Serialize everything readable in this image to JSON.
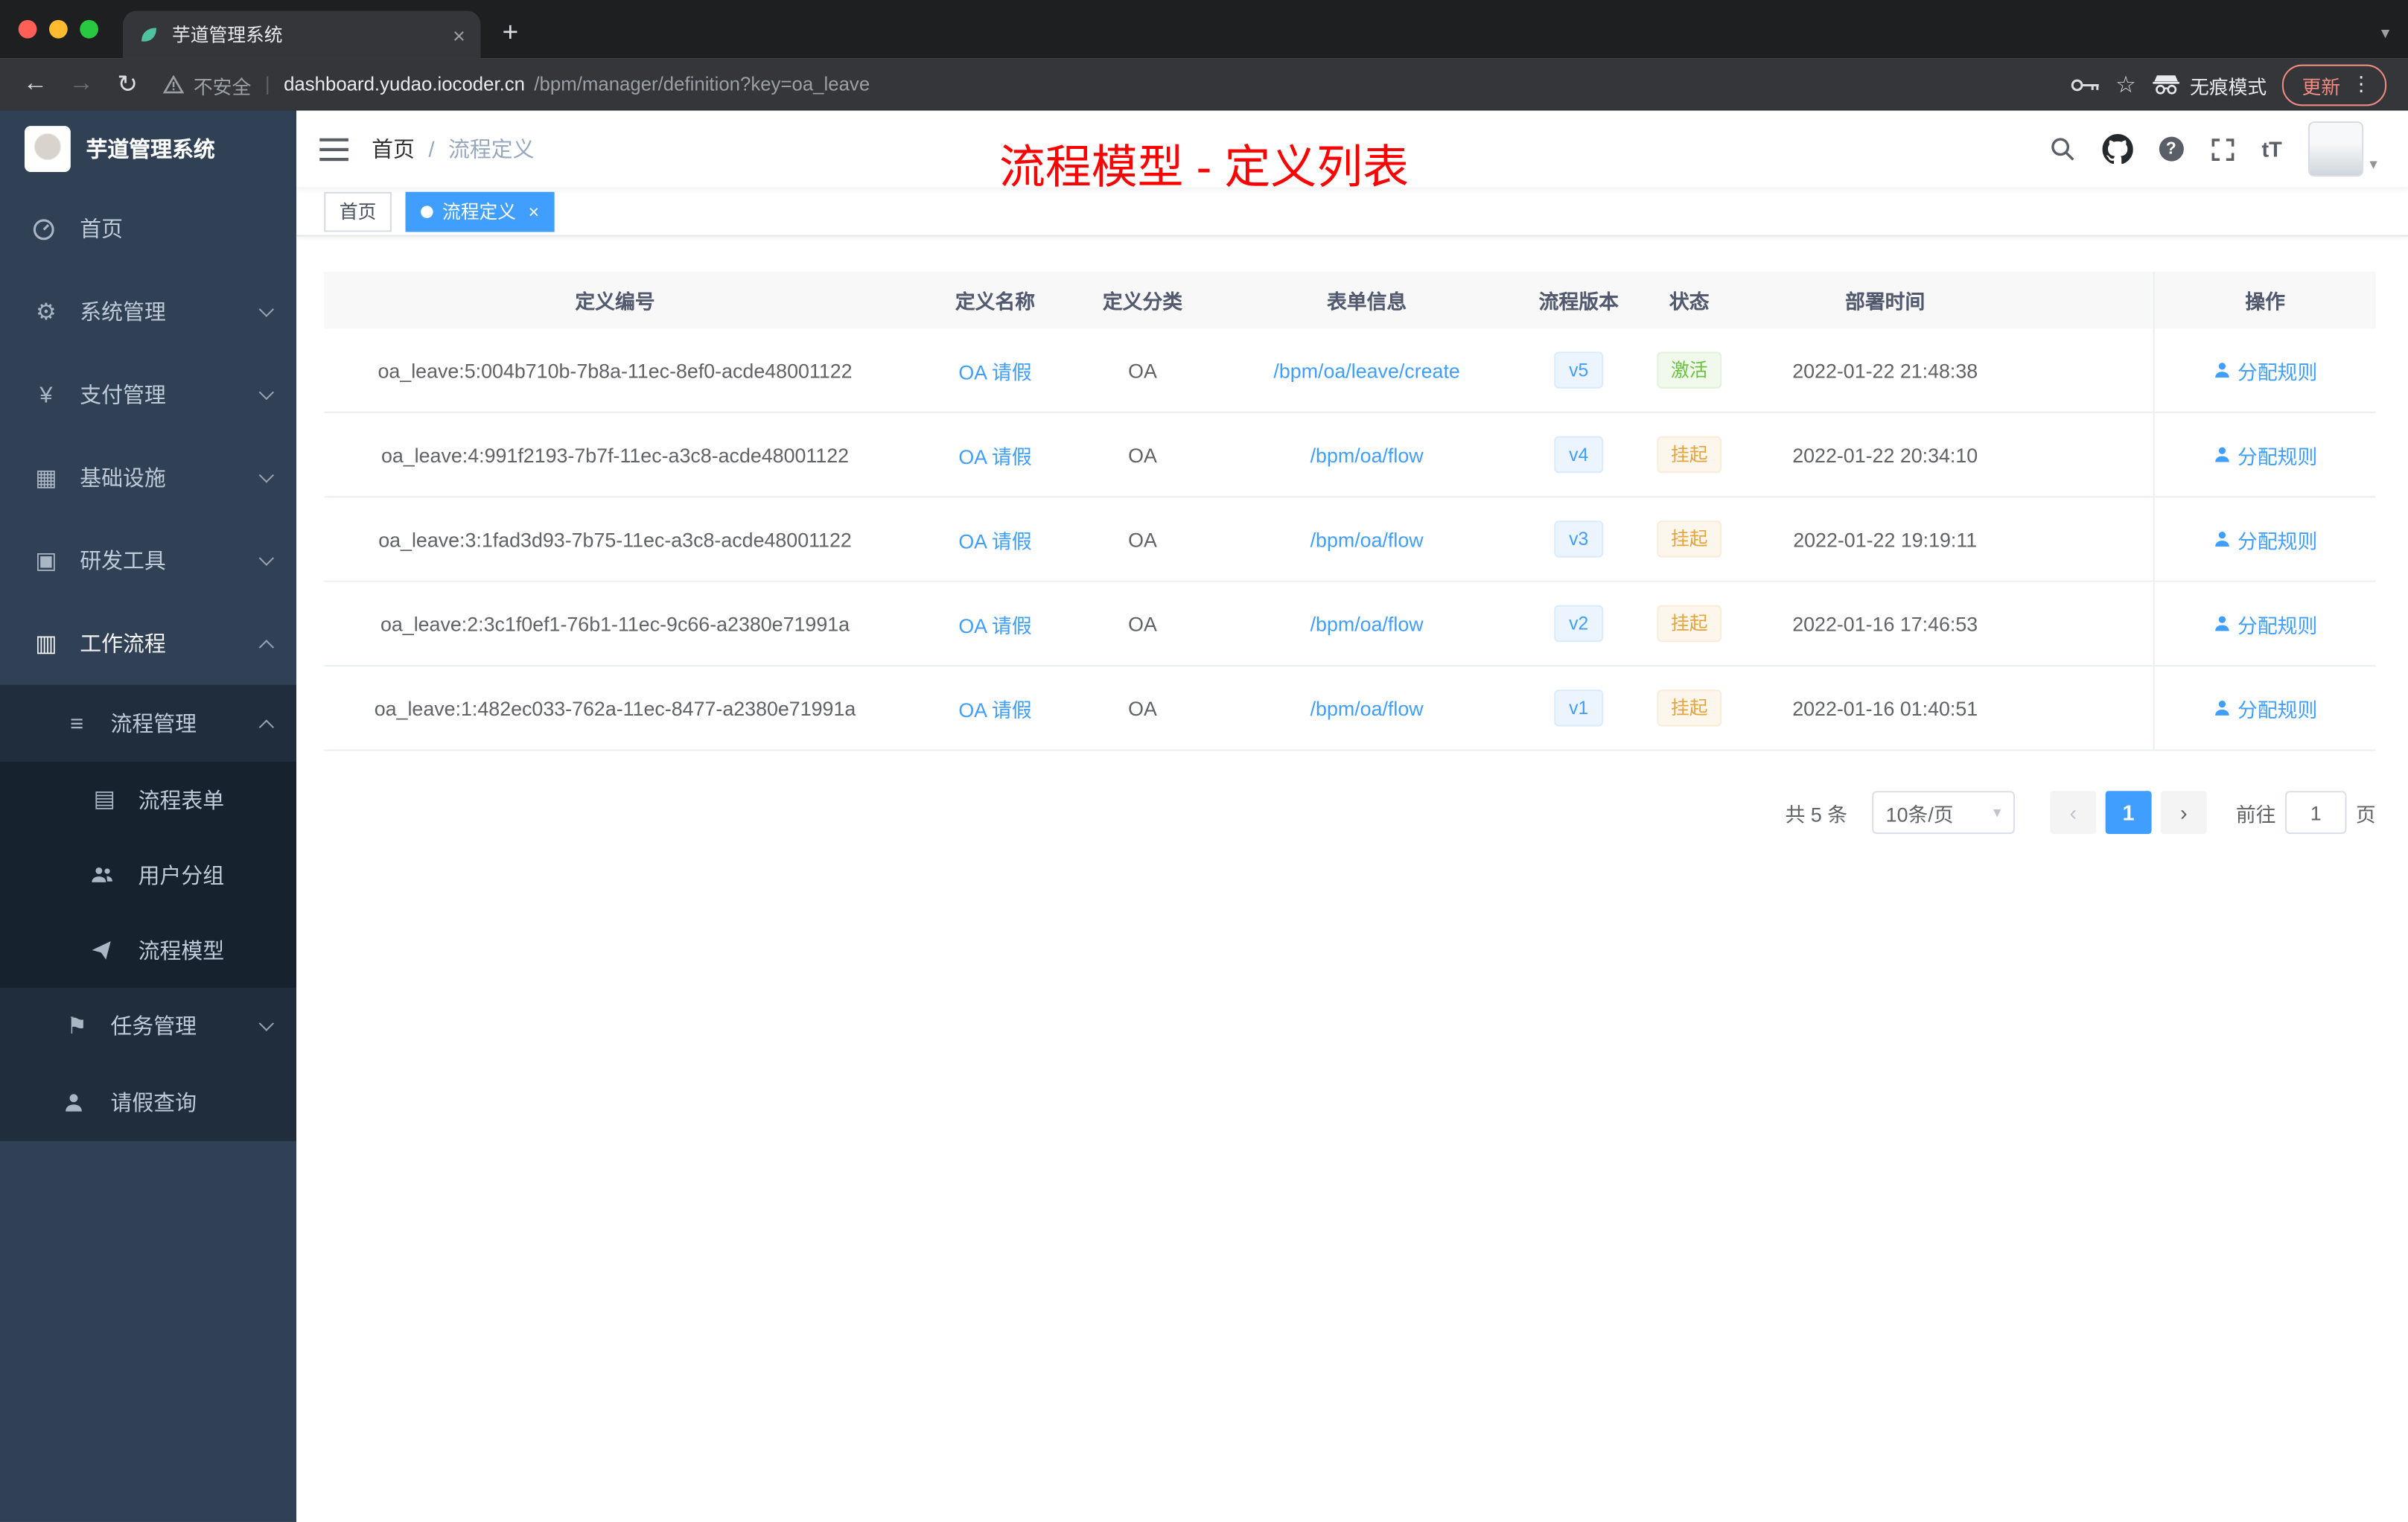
{
  "colors": {
    "accent": "#409eff",
    "success": "#67c23a",
    "warning": "#e6a23c",
    "annotation_red": "#ff0000",
    "sidebar_bg": "#304156",
    "submenu_bg": "#1f2d3d"
  },
  "browser": {
    "tab_title": "芋道管理系统",
    "security_label": "不安全",
    "url_host": "dashboard.yudao.iocoder.cn",
    "url_path": "/bpm/manager/definition?key=oa_leave",
    "incognito_label": "无痕模式",
    "update_label": "更新"
  },
  "sidebar": {
    "app_title": "芋道管理系统",
    "items": [
      {
        "label": "首页"
      },
      {
        "label": "系统管理"
      },
      {
        "label": "支付管理"
      },
      {
        "label": "基础设施"
      },
      {
        "label": "研发工具"
      },
      {
        "label": "工作流程"
      },
      {
        "label": "流程管理"
      },
      {
        "label": "流程表单"
      },
      {
        "label": "用户分组"
      },
      {
        "label": "流程模型"
      },
      {
        "label": "任务管理"
      },
      {
        "label": "请假查询"
      }
    ]
  },
  "navbar": {
    "breadcrumb_home": "首页",
    "breadcrumb_sep": "/",
    "breadcrumb_current": "流程定义",
    "annotation": "流程模型 - 定义列表",
    "font_icon_label": "tT"
  },
  "tags": {
    "home": "首页",
    "active": "流程定义"
  },
  "table": {
    "columns": [
      "定义编号",
      "定义名称",
      "定义分类",
      "表单信息",
      "流程版本",
      "状态",
      "部署时间",
      "操作"
    ],
    "rows": [
      {
        "id": "oa_leave:5:004b710b-7b8a-11ec-8ef0-acde48001122",
        "name": "OA 请假",
        "category": "OA",
        "form": "/bpm/oa/leave/create",
        "version": "v5",
        "status": "激活",
        "status_type": "success",
        "time": "2022-01-22 21:48:38",
        "action": "分配规则"
      },
      {
        "id": "oa_leave:4:991f2193-7b7f-11ec-a3c8-acde48001122",
        "name": "OA 请假",
        "category": "OA",
        "form": "/bpm/oa/flow",
        "version": "v4",
        "status": "挂起",
        "status_type": "warning",
        "time": "2022-01-22 20:34:10",
        "action": "分配规则"
      },
      {
        "id": "oa_leave:3:1fad3d93-7b75-11ec-a3c8-acde48001122",
        "name": "OA 请假",
        "category": "OA",
        "form": "/bpm/oa/flow",
        "version": "v3",
        "status": "挂起",
        "status_type": "warning",
        "time": "2022-01-22 19:19:11",
        "action": "分配规则"
      },
      {
        "id": "oa_leave:2:3c1f0ef1-76b1-11ec-9c66-a2380e71991a",
        "name": "OA 请假",
        "category": "OA",
        "form": "/bpm/oa/flow",
        "version": "v2",
        "status": "挂起",
        "status_type": "warning",
        "time": "2022-01-16 17:46:53",
        "action": "分配规则"
      },
      {
        "id": "oa_leave:1:482ec033-762a-11ec-8477-a2380e71991a",
        "name": "OA 请假",
        "category": "OA",
        "form": "/bpm/oa/flow",
        "version": "v1",
        "status": "挂起",
        "status_type": "warning",
        "time": "2022-01-16 01:40:51",
        "action": "分配规则"
      }
    ]
  },
  "pagination": {
    "total": "共 5 条",
    "page_size": "10条/页",
    "current_page": "1",
    "goto_label": "前往",
    "goto_value": "1",
    "page_unit": "页"
  }
}
